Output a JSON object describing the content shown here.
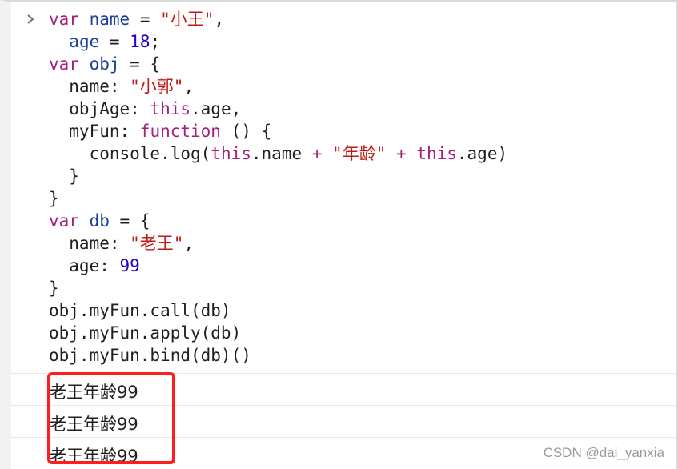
{
  "console": {
    "prompt_icon": "chevron-right-icon",
    "code_lines": [
      {
        "tokens": [
          {
            "t": "var",
            "c": "kw"
          },
          {
            "t": " ",
            "c": "plain"
          },
          {
            "t": "name",
            "c": "var"
          },
          {
            "t": " = ",
            "c": "plain"
          },
          {
            "t": "\"小王\"",
            "c": "str"
          },
          {
            "t": ",",
            "c": "plain"
          }
        ]
      },
      {
        "tokens": [
          {
            "t": "  ",
            "c": "plain"
          },
          {
            "t": "age",
            "c": "var"
          },
          {
            "t": " = ",
            "c": "plain"
          },
          {
            "t": "18",
            "c": "num"
          },
          {
            "t": ";",
            "c": "plain"
          }
        ]
      },
      {
        "tokens": [
          {
            "t": "var",
            "c": "kw"
          },
          {
            "t": " ",
            "c": "plain"
          },
          {
            "t": "obj",
            "c": "var"
          },
          {
            "t": " = {",
            "c": "plain"
          }
        ]
      },
      {
        "tokens": [
          {
            "t": "  name: ",
            "c": "plain"
          },
          {
            "t": "\"小郭\"",
            "c": "str"
          },
          {
            "t": ",",
            "c": "plain"
          }
        ]
      },
      {
        "tokens": [
          {
            "t": "  objAge: ",
            "c": "plain"
          },
          {
            "t": "this",
            "c": "kw"
          },
          {
            "t": ".age,",
            "c": "plain"
          }
        ]
      },
      {
        "tokens": [
          {
            "t": "  myFun: ",
            "c": "plain"
          },
          {
            "t": "function",
            "c": "kw"
          },
          {
            "t": " () {",
            "c": "plain"
          }
        ]
      },
      {
        "tokens": [
          {
            "t": "    console.log(",
            "c": "plain"
          },
          {
            "t": "this",
            "c": "kw"
          },
          {
            "t": ".name ",
            "c": "plain"
          },
          {
            "t": "+",
            "c": "op"
          },
          {
            "t": " ",
            "c": "plain"
          },
          {
            "t": "\"年龄\"",
            "c": "str"
          },
          {
            "t": " ",
            "c": "plain"
          },
          {
            "t": "+",
            "c": "op"
          },
          {
            "t": " ",
            "c": "plain"
          },
          {
            "t": "this",
            "c": "kw"
          },
          {
            "t": ".age)",
            "c": "plain"
          }
        ]
      },
      {
        "tokens": [
          {
            "t": "  }",
            "c": "plain"
          }
        ]
      },
      {
        "tokens": [
          {
            "t": "}",
            "c": "plain"
          }
        ]
      },
      {
        "tokens": [
          {
            "t": "var",
            "c": "kw"
          },
          {
            "t": " ",
            "c": "plain"
          },
          {
            "t": "db",
            "c": "var"
          },
          {
            "t": " = {",
            "c": "plain"
          }
        ]
      },
      {
        "tokens": [
          {
            "t": "  name: ",
            "c": "plain"
          },
          {
            "t": "\"老王\"",
            "c": "str"
          },
          {
            "t": ",",
            "c": "plain"
          }
        ]
      },
      {
        "tokens": [
          {
            "t": "  age: ",
            "c": "plain"
          },
          {
            "t": "99",
            "c": "num"
          }
        ]
      },
      {
        "tokens": [
          {
            "t": "}",
            "c": "plain"
          }
        ]
      },
      {
        "tokens": [
          {
            "t": "obj.myFun.call(db)",
            "c": "plain"
          }
        ]
      },
      {
        "tokens": [
          {
            "t": "obj.myFun.apply(db)",
            "c": "plain"
          }
        ]
      },
      {
        "tokens": [
          {
            "t": "obj.myFun.bind(db)()",
            "c": "plain"
          }
        ]
      }
    ],
    "outputs": [
      {
        "text": "老王年龄99"
      },
      {
        "text": "老王年龄99"
      },
      {
        "text": "老王年龄99"
      }
    ]
  },
  "colors": {
    "keyword": "#a3207f",
    "variable": "#1d3f9c",
    "string": "#c41a16",
    "number": "#1c00cf",
    "highlight_box": "#ff1d1d"
  },
  "watermark": "CSDN @dai_yanxia"
}
